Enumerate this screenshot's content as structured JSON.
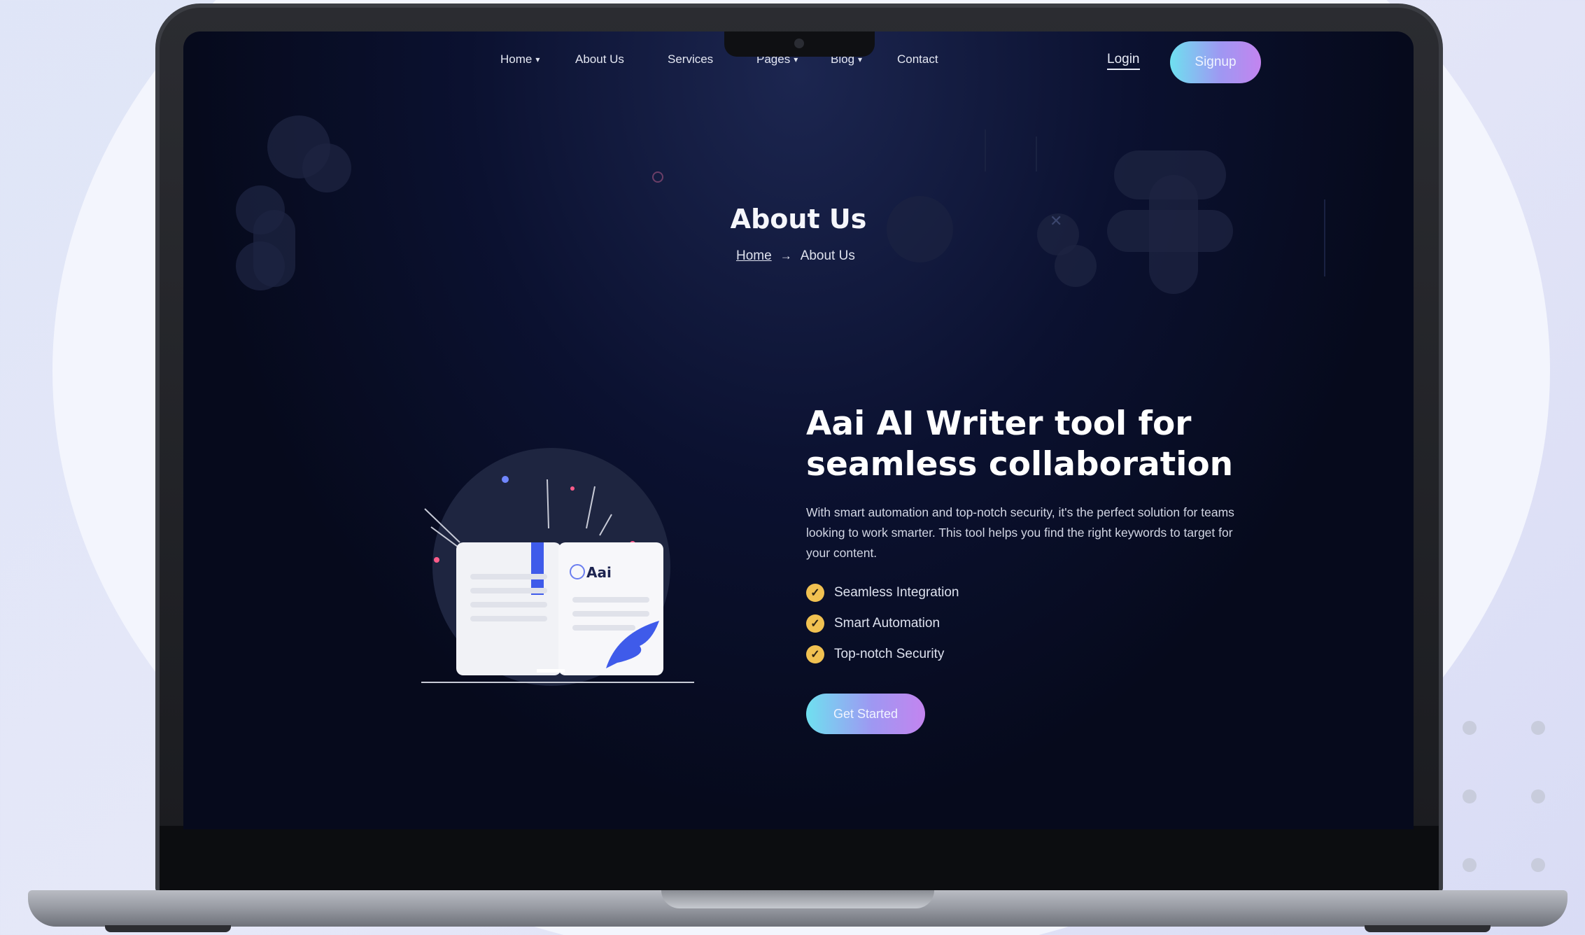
{
  "nav": {
    "items": [
      {
        "label": "Home",
        "has_dropdown": true
      },
      {
        "label": "About Us",
        "has_dropdown": false
      },
      {
        "label": "Services",
        "has_dropdown": false
      },
      {
        "label": "Pages",
        "has_dropdown": true
      },
      {
        "label": "Blog",
        "has_dropdown": true
      },
      {
        "label": "Contact",
        "has_dropdown": false
      }
    ],
    "login": "Login",
    "signup": "Signup"
  },
  "hero": {
    "title": "About Us",
    "breadcrumb": {
      "home": "Home",
      "separator": "→",
      "current": "About Us"
    }
  },
  "about": {
    "heading": "Aai AI Writer tool for seamless collaboration",
    "description": "With smart automation and top-notch security, it's the perfect solution for teams looking to work smarter. This tool helps you find the right keywords to target for your content.",
    "features": [
      "Seamless Integration",
      "Smart Automation",
      "Top-notch Security"
    ],
    "cta": "Get Started",
    "illustration_brand": "Aai"
  },
  "colors": {
    "accent_gradient": [
      "#6fe0f0",
      "#9e98f2",
      "#c384ef"
    ],
    "check": "#f1c151",
    "screen_bg": "#070b1f",
    "bookmark": "#3f5bea"
  },
  "icons": {
    "dropdown": "chevron-down-icon",
    "check": "check-circle-icon",
    "arrow": "arrow-right-icon"
  }
}
